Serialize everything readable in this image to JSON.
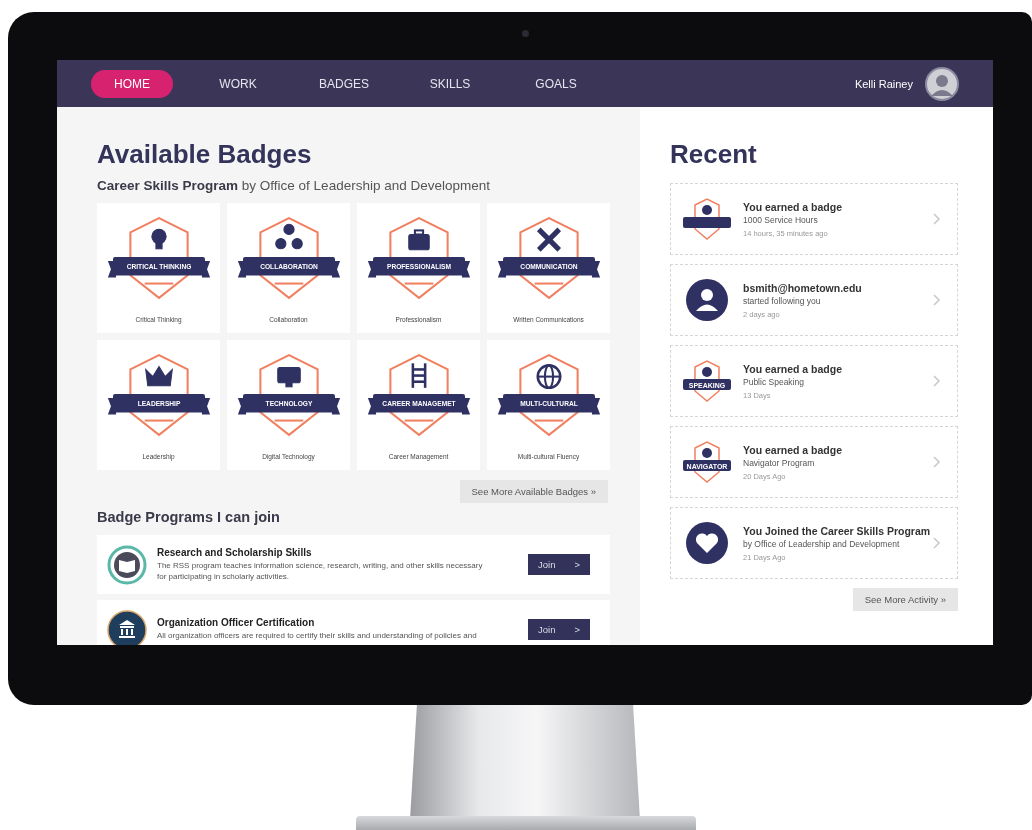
{
  "nav": {
    "tabs": [
      {
        "label": "HOME",
        "selected": true
      },
      {
        "label": "WORK",
        "selected": false
      },
      {
        "label": "BADGES",
        "selected": false
      },
      {
        "label": "SKILLS",
        "selected": false
      },
      {
        "label": "GOALS",
        "selected": false
      }
    ],
    "user": {
      "name": "Kelli Rainey"
    }
  },
  "available": {
    "title": "Available Badges",
    "program": "Career Skills Program",
    "by": "by Office of Leadership and Development",
    "badges": [
      {
        "ribbon": "CRITICAL THINKING",
        "kind": "bulb",
        "label": "Critical Thinking"
      },
      {
        "ribbon": "COLLABORATION",
        "kind": "people",
        "label": "Collaboration"
      },
      {
        "ribbon": "PROFESSIONALISM",
        "kind": "briefcase",
        "label": "Professionalism"
      },
      {
        "ribbon": "COMMUNICATION",
        "kind": "pencils",
        "label": "Written Communications"
      },
      {
        "ribbon": "LEADERSHIP",
        "kind": "crown",
        "label": "Leadership"
      },
      {
        "ribbon": "TECHNOLOGY",
        "kind": "monitor",
        "label": "Digital Technology"
      },
      {
        "ribbon": "CAREER MANAGEMET",
        "kind": "ladder",
        "label": "Career Management"
      },
      {
        "ribbon": "MULTI-CULTURAL",
        "kind": "globe",
        "label": "Multi-cultural Fluency"
      }
    ],
    "more": "See  More Available Badges",
    "more_mark": "»"
  },
  "programs": {
    "title": "Badge Programs I can join",
    "items": [
      {
        "kind": "book",
        "name": "Research and Scholarship Skills",
        "description": "The RSS program teaches information science, research, writing, and other skills necessary for participating in scholarly activities.",
        "button": "Join",
        "caret": ">"
      },
      {
        "kind": "building",
        "name": "Organization Officer Certification",
        "description": "All organization officers are required to certify their skills and understanding of policies and",
        "button": "Join",
        "caret": ">"
      }
    ]
  },
  "recent": {
    "title": "Recent",
    "items": [
      {
        "kind": "badge",
        "title": "You earned a badge",
        "detail": "1000 Service Hours",
        "time": "14 hours, 35 minutes ago"
      },
      {
        "kind": "person",
        "title": "bsmith@hometown.edu",
        "detail": "started following you",
        "time": "2 days ago"
      },
      {
        "kind": "badge",
        "ribbon": "SPEAKING",
        "title": "You earned a badge",
        "detail": "Public Speaking",
        "time": "13 Days"
      },
      {
        "kind": "badge",
        "ribbon": "NAVIGATOR",
        "title": "You earned a badge",
        "detail": "Navigator Program",
        "time": "20 Days Ago"
      },
      {
        "kind": "heart",
        "title": "You Joined the Career Skills Program",
        "detail": "by Office of Leadership and Development",
        "time": "21 Days Ago"
      }
    ],
    "more": "See  More Activity",
    "more_mark": "»"
  }
}
